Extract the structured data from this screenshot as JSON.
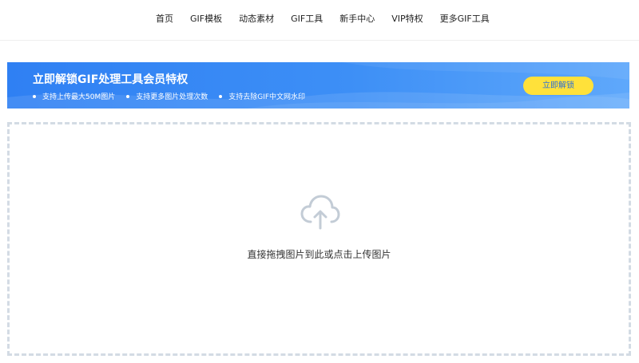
{
  "nav": {
    "items": [
      {
        "label": "首页"
      },
      {
        "label": "GIF模板"
      },
      {
        "label": "动态素材"
      },
      {
        "label": "GIF工具"
      },
      {
        "label": "新手中心"
      },
      {
        "label": "VIP特权"
      },
      {
        "label": "更多GIF工具"
      }
    ]
  },
  "banner": {
    "title": "立即解锁GIF处理工具会员特权",
    "features": [
      "支持上传最大50M图片",
      "支持更多图片处理次数",
      "支持去除GIF中文网水印"
    ],
    "button_label": "立即解锁",
    "colors": {
      "background": "#3d8ff6",
      "button": "#ffe13a",
      "button_text": "#2c6fd8"
    }
  },
  "upload": {
    "icon": "cloud-upload-icon",
    "text": "直接拖拽图片到此或点击上传图片",
    "border_color": "#d3dbe4"
  }
}
